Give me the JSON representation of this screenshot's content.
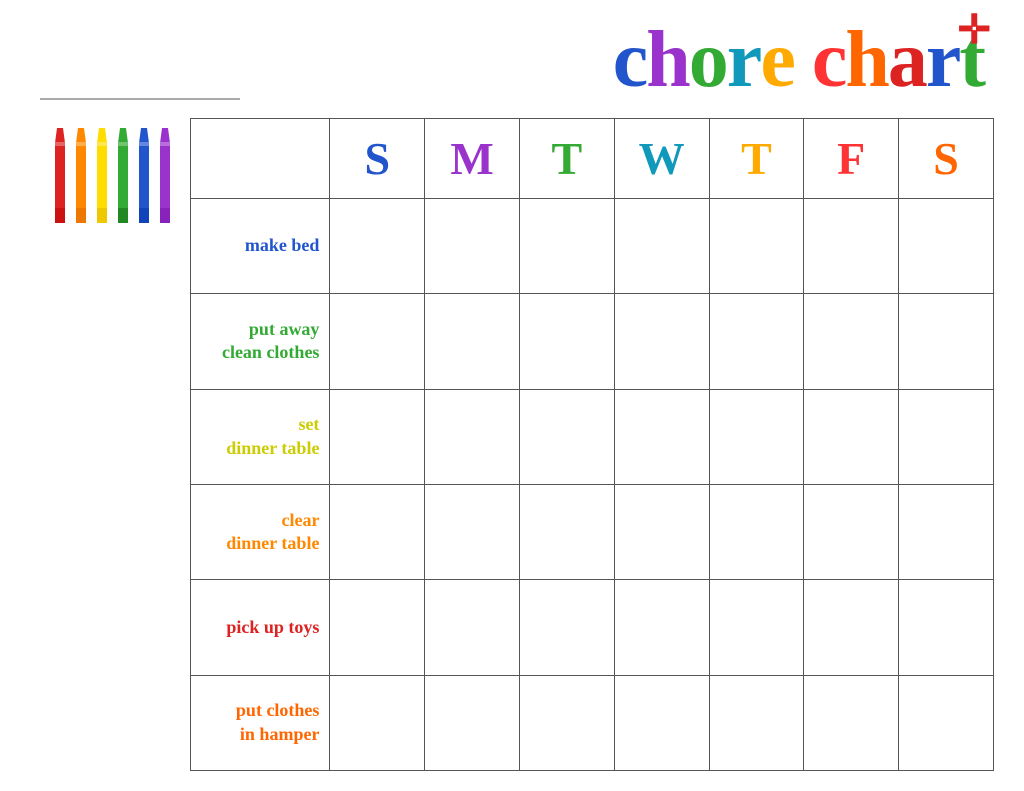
{
  "header": {
    "title": "chore chart",
    "title_letters": {
      "chore": [
        "c",
        "h",
        "o",
        "r",
        "e"
      ],
      "chart": [
        "c",
        "h",
        "a",
        "r",
        "t"
      ]
    }
  },
  "days": {
    "headers": [
      {
        "label": "S",
        "color": "#2255cc",
        "key": "sun"
      },
      {
        "label": "M",
        "color": "#9933cc",
        "key": "mon"
      },
      {
        "label": "T",
        "color": "#33aa33",
        "key": "tue"
      },
      {
        "label": "W",
        "color": "#1199bb",
        "key": "wed"
      },
      {
        "label": "T",
        "color": "#ffaa00",
        "key": "thu"
      },
      {
        "label": "F",
        "color": "#ff3333",
        "key": "fri"
      },
      {
        "label": "S",
        "color": "#ff6600",
        "key": "sat"
      }
    ]
  },
  "chores": [
    {
      "label": "make bed",
      "color": "#2255cc"
    },
    {
      "label": "put away\nclean clothes",
      "color": "#33aa33"
    },
    {
      "label": "set\ndinner table",
      "color": "#cccc00"
    },
    {
      "label": "clear\ndinner table",
      "color": "#ff8800"
    },
    {
      "label": "pick up toys",
      "color": "#dd2222"
    },
    {
      "label": "put clothes\nin hamper",
      "color": "#ff6600"
    }
  ],
  "crayons": [
    {
      "color": "#dd2222"
    },
    {
      "color": "#ff8800"
    },
    {
      "color": "#ffdd00"
    },
    {
      "color": "#33aa33"
    },
    {
      "color": "#2255cc"
    },
    {
      "color": "#9933cc"
    }
  ]
}
